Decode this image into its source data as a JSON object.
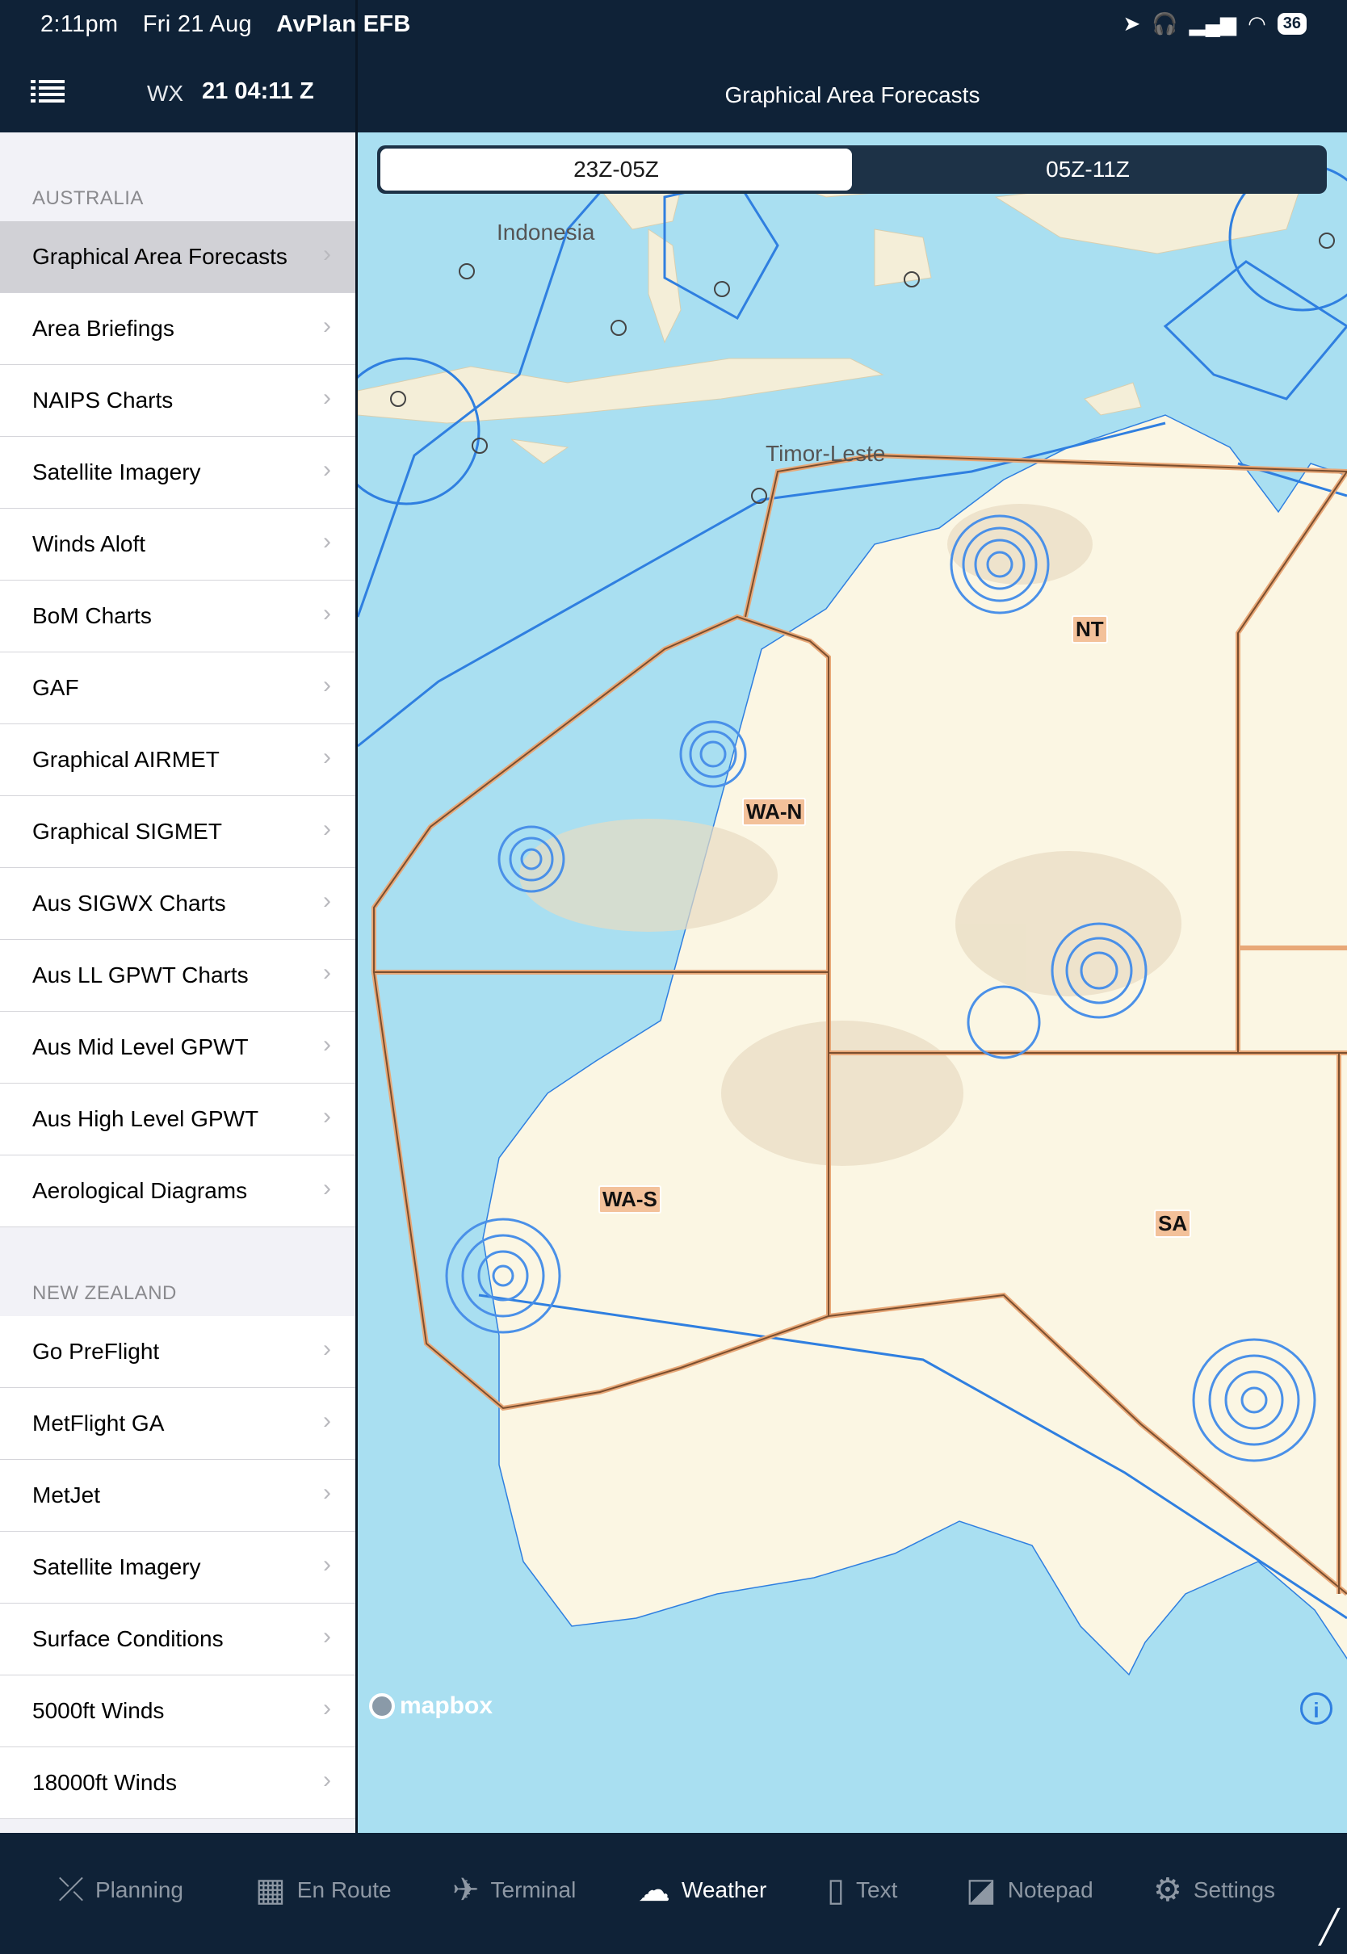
{
  "status_bar": {
    "time": "2:11pm",
    "date": "Fri 21 Aug",
    "app_name": "AvPlan EFB",
    "battery": "36"
  },
  "sidebar_header": {
    "wx_label": "WX",
    "wx_time": "21 04:11 Z"
  },
  "page_title": "Graphical Area Forecasts",
  "sections": [
    {
      "title": "AUSTRALIA",
      "items": [
        "Graphical Area Forecasts",
        "Area Briefings",
        "NAIPS Charts",
        "Satellite Imagery",
        "Winds Aloft",
        "BoM Charts",
        "GAF",
        "Graphical AIRMET",
        "Graphical SIGMET",
        "Aus SIGWX Charts",
        "Aus LL GPWT Charts",
        "Aus Mid Level GPWT",
        "Aus High Level GPWT",
        "Aerological Diagrams"
      ]
    },
    {
      "title": "NEW ZEALAND",
      "items": [
        "Go PreFlight",
        "MetFlight GA",
        "MetJet",
        "Satellite Imagery",
        "Surface Conditions",
        "5000ft Winds",
        "18000ft Winds"
      ]
    }
  ],
  "time_segments": [
    "23Z-05Z",
    "05Z-11Z"
  ],
  "map": {
    "place_labels": [
      "Indonesia",
      "Timor-Leste"
    ],
    "regions": [
      "NT",
      "WA-N",
      "WA-S",
      "SA"
    ],
    "attribution": "mapbox",
    "info_glyph": "i"
  },
  "tab_bar": [
    {
      "label": "Planning",
      "icon": "planning-icon"
    },
    {
      "label": "En Route",
      "icon": "map-icon"
    },
    {
      "label": "Terminal",
      "icon": "airplane-icon"
    },
    {
      "label": "Weather",
      "icon": "cloud-lightning-icon"
    },
    {
      "label": "Text",
      "icon": "document-icon"
    },
    {
      "label": "Notepad",
      "icon": "notepad-icon"
    },
    {
      "label": "Settings",
      "icon": "gear-icon"
    }
  ],
  "colors": {
    "navy": "#0f2237",
    "sea": "#a9dff1",
    "land": "#fbf6e3",
    "boundary": "#2f7fe0",
    "region_border": "#e8a878"
  }
}
